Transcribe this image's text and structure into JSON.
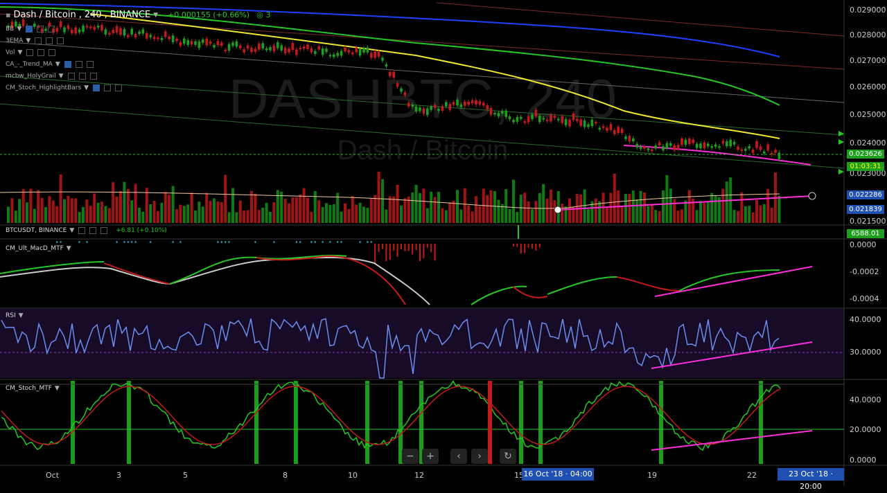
{
  "header": {
    "symbol": "Dash / Bitcoin",
    "interval": "240",
    "exchange": "BINANCE",
    "change": "+0.000155 (+0.66%)",
    "badge": "3",
    "watermark_main": "DASHBTC, 240",
    "watermark_sub": "Dash / Bitcoin"
  },
  "indicators": [
    {
      "label": "BB"
    },
    {
      "label": "3EMA"
    },
    {
      "label": "Vol"
    },
    {
      "label": "CA_-_Trend_MA"
    },
    {
      "label": "mcbw_HolyGrail"
    },
    {
      "label": "CM_Stoch_HighlightBars"
    }
  ],
  "price_axis": [
    "0.029000",
    "0.028000",
    "0.027000",
    "0.026000",
    "0.025000",
    "0.024000",
    "0.023000",
    "0.021500"
  ],
  "tags": {
    "last_price": "0.023626",
    "countdown": "01:03:31",
    "vol_a": "0.022286",
    "vol_b": "0.021839",
    "btc_price": "6588.01"
  },
  "btc_pane": {
    "symbol": "BTCUSDT, BINANCE",
    "change": "+6.81 (+0.10%)"
  },
  "macd_pane": {
    "label": "CM_Ult_MacD_MTF",
    "axis": [
      "0.0000",
      "-0.0002",
      "-0.0004"
    ]
  },
  "rsi_pane": {
    "label": "RSI",
    "axis": [
      "40.0000",
      "30.0000"
    ]
  },
  "stoch_pane": {
    "label": "CM_Stoch_MTF",
    "axis": [
      "40.0000",
      "20.0000",
      "0.0000"
    ]
  },
  "x_axis": {
    "labels": [
      "Oct",
      "3",
      "5",
      "8",
      "10",
      "12",
      "15",
      "19",
      "22"
    ],
    "crosshair_date": "16 Oct '18 · 04:00",
    "end_date": "23 Oct '18 · 20:00"
  },
  "nav": {
    "zoom_out": "−",
    "zoom_in": "+",
    "prev": "‹",
    "next": "›",
    "reset": "↻"
  },
  "colors": {
    "up": "#1e9e1e",
    "down": "#c41a1a",
    "ema_yellow": "#f0e830",
    "ema_green": "#26c626",
    "ema_blue": "#1f3fff",
    "trend_pink": "#ff2ed8",
    "rsi_line": "#6a8ff0",
    "macd_white": "#cccccc"
  }
}
